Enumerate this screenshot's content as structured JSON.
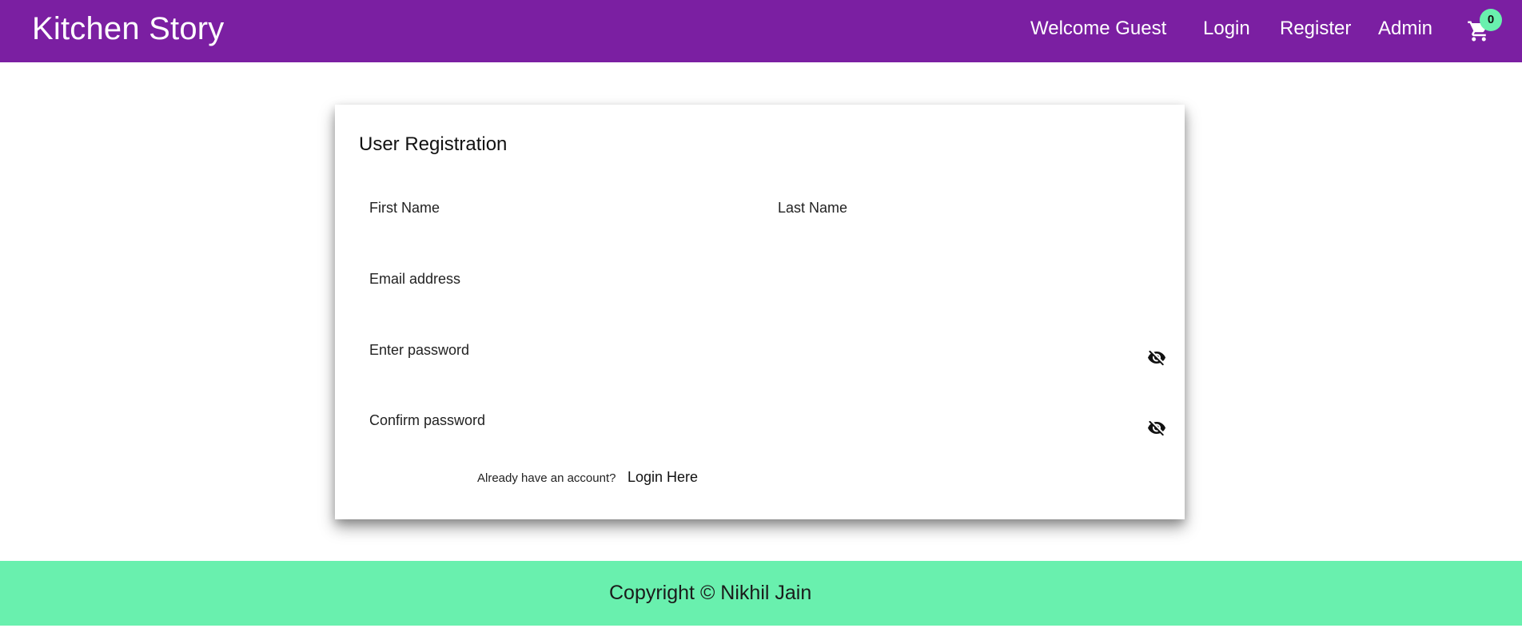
{
  "navbar": {
    "brand": "Kitchen Story",
    "welcome": "Welcome Guest",
    "login": "Login",
    "register": "Register",
    "admin": "Admin",
    "cart_icon": "shopping-cart-icon",
    "cart_count": "0",
    "bg_color": "#7b1fa2"
  },
  "form": {
    "title": "User Registration",
    "first_name_label": "First Name",
    "first_name_value": "",
    "last_name_label": "Last Name",
    "last_name_value": "",
    "email_label": "Email address",
    "email_value": "",
    "password_label": "Enter password",
    "password_value": "",
    "confirm_label": "Confirm password",
    "confirm_value": "",
    "visibility_icon": "visibility-off-icon",
    "account_text": "Already have an account?",
    "login_link": "Login Here"
  },
  "footer": {
    "text": "Copyright © Nikhil Jain",
    "bg_color": "#69f0ae"
  }
}
